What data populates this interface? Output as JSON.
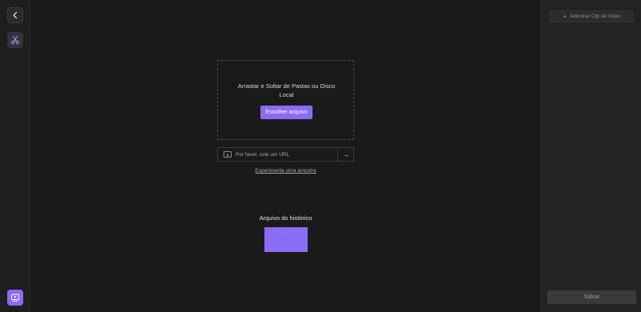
{
  "icons": {
    "back": "chevron-left-icon",
    "cut": "scissors-icon",
    "media": "media-icon",
    "link": "link-icon",
    "arrow": "arrow-right-icon",
    "plus": "plus-icon"
  },
  "colors": {
    "accent": "#8a6cf5",
    "background": "#1a1a1a",
    "panel": "#232323"
  },
  "dropzone": {
    "text": "Arrastar e Soltar de Pastas ou Disco Local",
    "button_label": "Escolher arquivo"
  },
  "url": {
    "placeholder": "Por favor, cole um URL",
    "go_symbol": "→"
  },
  "sample": {
    "link_text": "Experimente uma amostra"
  },
  "history": {
    "title": "Arquivo do histórico",
    "thumb_text": "···"
  },
  "right_panel": {
    "add_clip_plus": "+",
    "add_clip_label": "Adicionar Clip de Vídeo",
    "save_label": "Salvar"
  }
}
